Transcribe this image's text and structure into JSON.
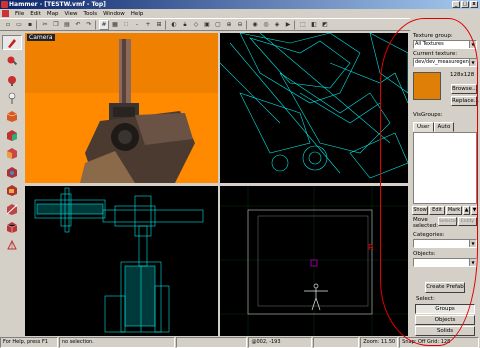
{
  "window": {
    "title": "Hammer - [TESTW.vmf - Top]",
    "controls": [
      "_",
      "□",
      "x"
    ]
  },
  "menu": [
    "File",
    "Edit",
    "Map",
    "View",
    "Tools",
    "Window",
    "Help"
  ],
  "viewports": {
    "camera_label": "Camera"
  },
  "panel": {
    "texture_group_label": "Texture group:",
    "texture_group_value": "All Textures",
    "current_texture_label": "Current texture:",
    "current_texture_value": "dev/dev_measuregene",
    "texture_size": "128x128",
    "browse_label": "Browse...",
    "replace_label": "Replace...",
    "visgroups_label": "VisGroups:",
    "tab_user": "User",
    "tab_auto": "Auto",
    "show_label": "Show",
    "edit_label": "Edit",
    "mark_label": "Mark",
    "move_selected_label": "Move selected:",
    "move_btn1": "Selected",
    "move_btn2": "Entity",
    "categories_label": "Categories:",
    "objects_label": "Objects:",
    "create_prefab_label": "Create Prefab",
    "select_label": "Select:",
    "groups_label": "Groups",
    "objects_btn_label": "Objects",
    "solids_label": "Solids"
  },
  "status": {
    "help": "For Help, press F1",
    "selection": "no selection.",
    "coords": "@002, -193",
    "zoom": "Zoom: 11.50",
    "snap": "Snap: Off Grid: 128"
  },
  "colors": {
    "wireframe": "#00e5e5",
    "camera_bg": "#ff8a00",
    "annotation": "#e00000"
  }
}
